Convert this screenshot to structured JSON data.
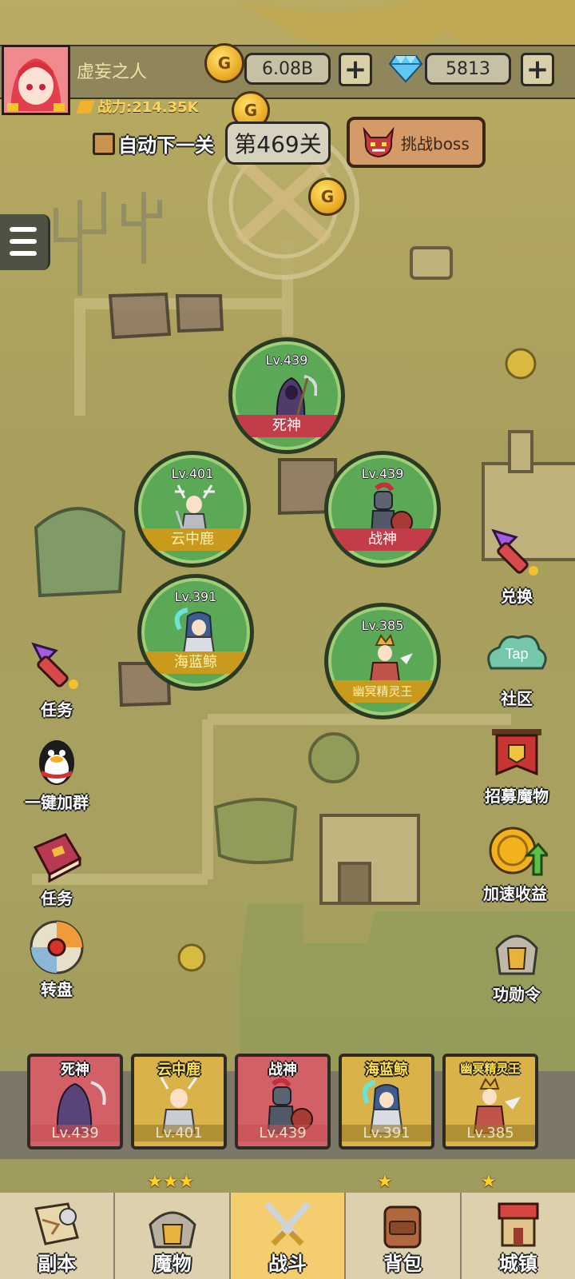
{
  "player": {
    "name": "虚妄之人",
    "power_label": "战力:214.35K"
  },
  "currency": {
    "gold_value": "6.08B",
    "gem_value": "5813",
    "plus_label": "+",
    "gold_icon": "gold-coin-icon",
    "gem_icon": "diamond-icon"
  },
  "stage": {
    "auto_next_label": "自动下一关",
    "auto_next_checked": false,
    "level_label": "第469关",
    "boss_button_label": "挑战boss"
  },
  "formation": [
    {
      "name": "死神",
      "level": "Lv.439",
      "band": "red"
    },
    {
      "name": "云中鹿",
      "level": "Lv.401",
      "band": "gold"
    },
    {
      "name": "战神",
      "level": "Lv.439",
      "band": "red"
    },
    {
      "name": "海蓝鲸",
      "level": "Lv.391",
      "band": "gold"
    },
    {
      "name": "幽冥精灵王",
      "level": "Lv.385",
      "band": "gold"
    }
  ],
  "left_menu": [
    {
      "label": "任务",
      "icon": "rocket-icon"
    },
    {
      "label": "一键加群",
      "icon": "penguin-icon"
    },
    {
      "label": "任务",
      "icon": "book-icon"
    },
    {
      "label": "转盘",
      "icon": "wheel-icon"
    }
  ],
  "right_menu": [
    {
      "label": "兑换",
      "icon": "rocket-icon"
    },
    {
      "label": "社区",
      "icon": "tap-cloud-icon",
      "badge": "Tap"
    },
    {
      "label": "招募魔物",
      "icon": "banner-icon"
    },
    {
      "label": "加速收益",
      "icon": "coin-arrow-icon"
    },
    {
      "label": "功勋令",
      "icon": "helmet-icon"
    }
  ],
  "team": [
    {
      "name": "死神",
      "level": "Lv.439",
      "stars": "",
      "color": "red"
    },
    {
      "name": "云中鹿",
      "level": "Lv.401",
      "stars": "★★★",
      "color": "gold"
    },
    {
      "name": "战神",
      "level": "Lv.439",
      "stars": "",
      "color": "red"
    },
    {
      "name": "海蓝鲸",
      "level": "Lv.391",
      "stars": "★",
      "color": "gold"
    },
    {
      "name": "幽冥精灵王",
      "level": "Lv.385",
      "stars": "★",
      "color": "gold"
    }
  ],
  "nav": [
    {
      "label": "副本",
      "icon": "map-scroll-icon",
      "active": false
    },
    {
      "label": "魔物",
      "icon": "monster-helmet-icon",
      "active": false
    },
    {
      "label": "战斗",
      "icon": "crossed-swords-icon",
      "active": true
    },
    {
      "label": "背包",
      "icon": "backpack-icon",
      "active": false
    },
    {
      "label": "城镇",
      "icon": "shop-icon",
      "active": false
    }
  ],
  "colors": {
    "map_bg": "#b9ab62",
    "hero_circle": "#5ba857",
    "band_red": "#c23d49",
    "band_gold": "#c99a1b",
    "nav_active": "#f4ce6e"
  }
}
